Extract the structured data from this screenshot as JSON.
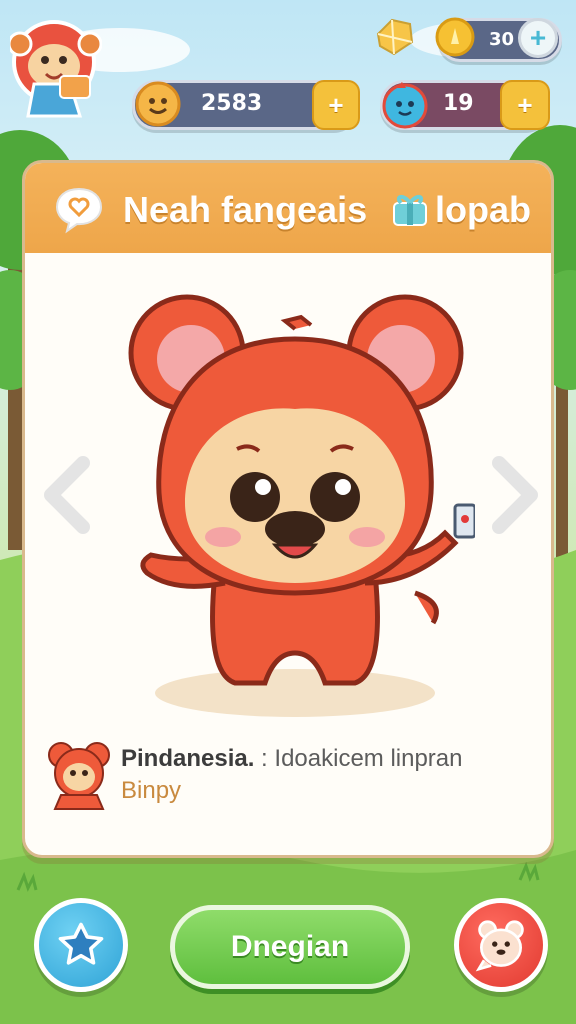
{
  "hud": {
    "coins_value": "2583",
    "gems_value": "19",
    "tickets_value": "30",
    "plus_label": "+"
  },
  "card": {
    "title": "Neah fangeais",
    "title_suffix": "lopab",
    "info_name": "Pindanesia.",
    "info_desc": " : Idoakicem linpran",
    "info_sub": "Binpy"
  },
  "actions": {
    "main_button_label": "Dnegian"
  },
  "colors": {
    "header_orange": "#eea64a",
    "main_green": "#5fbf3e",
    "left_blue": "#2fa3d6",
    "right_red": "#e13a30"
  },
  "icons": {
    "avatar": "monkey-avatar-icon",
    "coin": "smiley-coin-icon",
    "gem": "blue-creature-gem-icon",
    "ticket": "gold-ticket-icon",
    "crystal": "crystal-icon",
    "chat": "chat-bubble-heart-icon",
    "gift": "gift-box-icon",
    "left_nav": "chevron-left-icon",
    "right_nav": "chevron-right-icon",
    "bottom_left": "star-badge-icon",
    "bottom_right": "pet-face-icon"
  }
}
